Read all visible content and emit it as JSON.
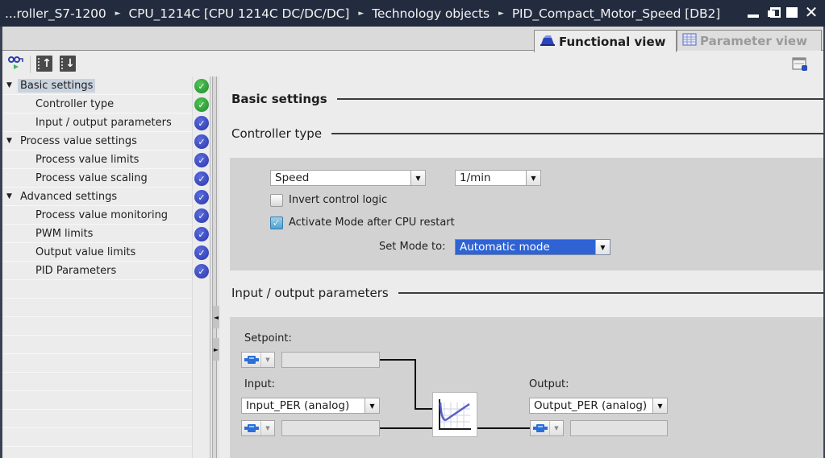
{
  "titlebar": {
    "breadcrumbs": [
      "...roller_S7-1200",
      "CPU_1214C [CPU 1214C DC/DC/DC]",
      "Technology objects",
      "PID_Compact_Motor_Speed [DB2]"
    ],
    "separator": "►",
    "controls": {
      "minimize": "minimize",
      "restore": "restore",
      "maximize": "maximize",
      "close": "✕"
    }
  },
  "tabs": [
    {
      "label": "Functional view",
      "icon": "functional-view-icon",
      "active": true
    },
    {
      "label": "Parameter view",
      "icon": "parameter-view-icon",
      "active": false
    }
  ],
  "toolbar": {
    "buttons": [
      "monitor-all-icon",
      "expand-all-icon",
      "collapse-all-icon"
    ],
    "right_button": "settings-window-icon"
  },
  "nav": {
    "items": [
      {
        "label": "Basic settings",
        "level": 0,
        "expanded": true,
        "selected": true,
        "status": "ok"
      },
      {
        "label": "Controller type",
        "level": 1,
        "status": "ok"
      },
      {
        "label": "Input / output parameters",
        "level": 1,
        "status": "info"
      },
      {
        "label": "Process value settings",
        "level": 0,
        "expanded": true,
        "status": "info"
      },
      {
        "label": "Process value limits",
        "level": 1,
        "status": "info"
      },
      {
        "label": "Process value scaling",
        "level": 1,
        "status": "info"
      },
      {
        "label": "Advanced settings",
        "level": 0,
        "expanded": true,
        "status": "info"
      },
      {
        "label": "Process value monitoring",
        "level": 1,
        "status": "info"
      },
      {
        "label": "PWM limits",
        "level": 1,
        "status": "info"
      },
      {
        "label": "Output value limits",
        "level": 1,
        "status": "info"
      },
      {
        "label": "PID Parameters",
        "level": 1,
        "status": "info"
      }
    ],
    "caret": "▼",
    "check": "✓"
  },
  "splitter": {
    "collapse_left": "◄",
    "expand_right": "►"
  },
  "content": {
    "basic_settings": {
      "title": "Basic settings"
    },
    "controller_type": {
      "title": "Controller type",
      "type_select": {
        "value": "Speed"
      },
      "unit_select": {
        "value": "1/min"
      },
      "invert_control_logic": {
        "label": "Invert control logic",
        "checked": false
      },
      "activate_mode": {
        "label": "Activate Mode after CPU restart",
        "checked": true
      },
      "set_mode": {
        "label": "Set Mode to:",
        "value": "Automatic mode"
      }
    },
    "io_params": {
      "title": "Input / output parameters",
      "setpoint": {
        "label": "Setpoint:",
        "value": ""
      },
      "input": {
        "label": "Input:",
        "select_value": "Input_PER (analog)",
        "value": ""
      },
      "output": {
        "label": "Output:",
        "select_value": "Output_PER (analog)",
        "value": ""
      }
    },
    "dropdown_arrow": "▼",
    "mini_arrow": "▼"
  },
  "colors": {
    "titlebar_bg": "#232b3e",
    "status_ok": "#2a9a34",
    "status_info": "#3440b8",
    "selection_blue": "#2f63d4"
  }
}
